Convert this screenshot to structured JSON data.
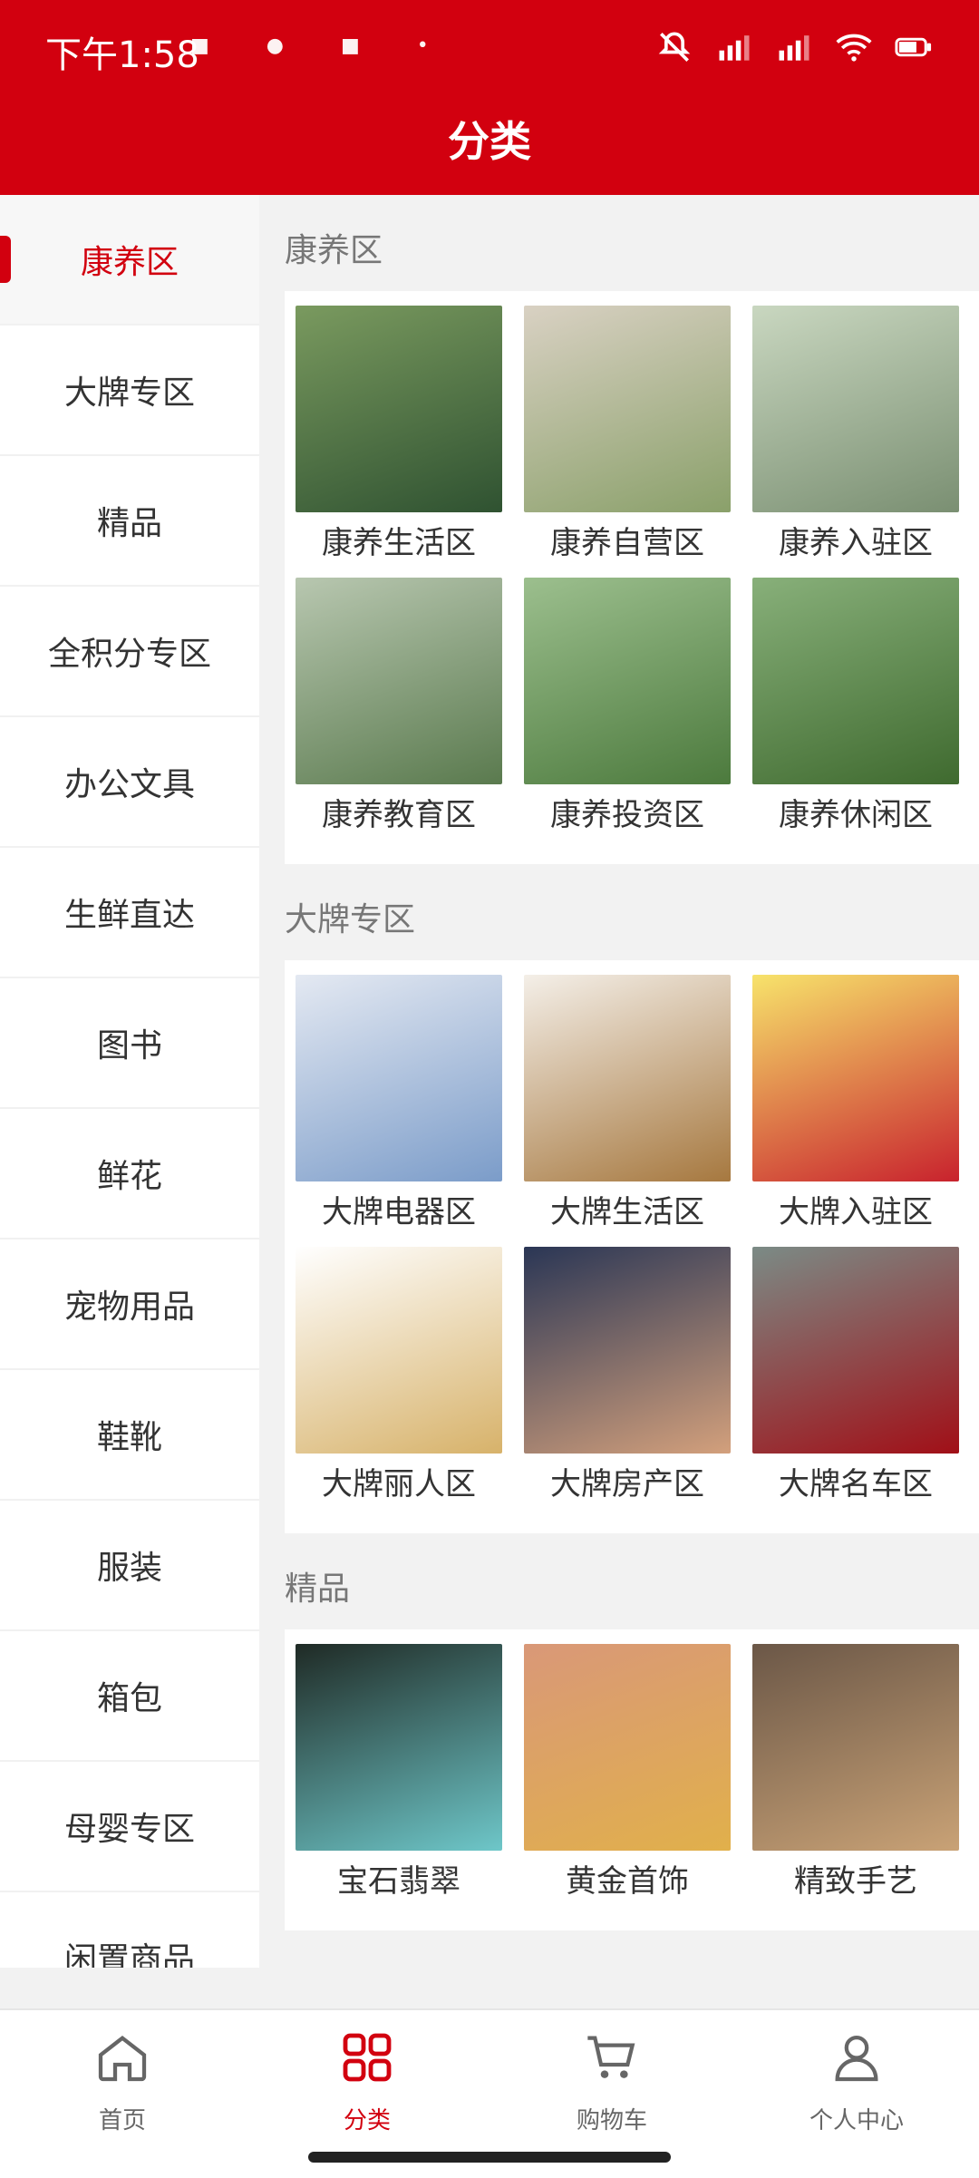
{
  "status": {
    "time": "下午1:58",
    "icons_left": [
      "notification-a",
      "notification-b",
      "notification-c",
      "dot"
    ],
    "icons_right": [
      "mute-icon",
      "signal-hd-icon",
      "signal-hd-icon",
      "wifi-icon",
      "battery-icon"
    ]
  },
  "header": {
    "title": "分类"
  },
  "sidebar": {
    "items": [
      {
        "label": "康养区",
        "active": true
      },
      {
        "label": "大牌专区"
      },
      {
        "label": "精品"
      },
      {
        "label": "全积分专区"
      },
      {
        "label": "办公文具"
      },
      {
        "label": "生鲜直达"
      },
      {
        "label": "图书"
      },
      {
        "label": "鲜花"
      },
      {
        "label": "宠物用品"
      },
      {
        "label": "鞋靴"
      },
      {
        "label": "服装"
      },
      {
        "label": "箱包"
      },
      {
        "label": "母婴专区"
      },
      {
        "label": "闲置商品"
      }
    ]
  },
  "sections": [
    {
      "title": "康养区",
      "items": [
        {
          "label": "康养生活区",
          "colors": [
            "#7a9a5f",
            "#2f5231"
          ]
        },
        {
          "label": "康养自营区",
          "colors": [
            "#d9d1c3",
            "#8aa06a"
          ]
        },
        {
          "label": "康养入驻区",
          "colors": [
            "#c9d7c0",
            "#7a8f72"
          ]
        },
        {
          "label": "康养教育区",
          "colors": [
            "#b8c7b0",
            "#5a7a4e"
          ]
        },
        {
          "label": "康养投资区",
          "colors": [
            "#9cbf8e",
            "#4c7a3d"
          ]
        },
        {
          "label": "康养休闲区",
          "colors": [
            "#88b07a",
            "#3f6a2f"
          ]
        }
      ]
    },
    {
      "title": "大牌专区",
      "items": [
        {
          "label": "大牌电器区",
          "colors": [
            "#e4e9f2",
            "#7b9cc9"
          ]
        },
        {
          "label": "大牌生活区",
          "colors": [
            "#f4efe8",
            "#a6783f"
          ]
        },
        {
          "label": "大牌入驻区",
          "colors": [
            "#f7e36b",
            "#c8222d"
          ]
        },
        {
          "label": "大牌丽人区",
          "colors": [
            "#ffffff",
            "#d7b26a"
          ]
        },
        {
          "label": "大牌房产区",
          "colors": [
            "#2a3655",
            "#d3a07c"
          ]
        },
        {
          "label": "大牌名车区",
          "colors": [
            "#7b8b86",
            "#a10f17"
          ]
        }
      ]
    },
    {
      "title": "精品",
      "items": [
        {
          "label": "宝石翡翠",
          "colors": [
            "#1f2a25",
            "#6ec7c9"
          ]
        },
        {
          "label": "黄金首饰",
          "colors": [
            "#d99878",
            "#e1b04b"
          ]
        },
        {
          "label": "精致手艺",
          "colors": [
            "#6b5747",
            "#c9a276"
          ]
        }
      ]
    }
  ],
  "bottom_nav": [
    {
      "label": "首页",
      "icon": "home-icon"
    },
    {
      "label": "分类",
      "icon": "category-grid-icon",
      "active": true
    },
    {
      "label": "购物车",
      "icon": "cart-icon"
    },
    {
      "label": "个人中心",
      "icon": "user-icon"
    }
  ],
  "colors": {
    "brand": "#d2000f",
    "text": "#333333",
    "muted": "#777777"
  }
}
